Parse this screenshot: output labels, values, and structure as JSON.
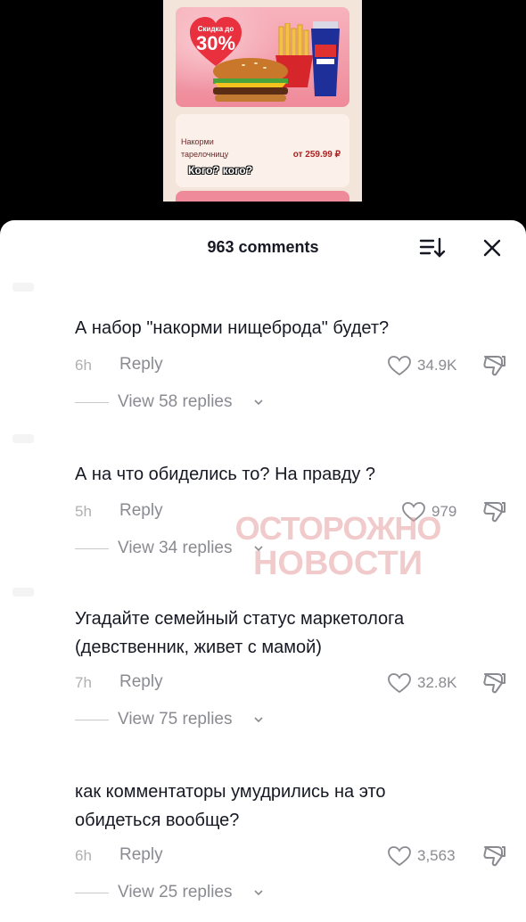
{
  "video": {
    "badge_small": "Скидка до",
    "badge_big": "30%",
    "product_name": "Накорми тарелочницу",
    "price": "от 259.99 ₽",
    "caption": "Кого? кого?"
  },
  "sheet": {
    "title": "963 comments",
    "sort_icon": "sort-icon",
    "close_icon": "close-icon"
  },
  "comments": [
    {
      "text": "А набор \"накорми нищеброда\" будет?",
      "time": "6h",
      "reply_label": "Reply",
      "likes": "34.9K",
      "view_replies": "View 58 replies"
    },
    {
      "text": "А на что обиделись то? На правду ?",
      "time": "5h",
      "reply_label": "Reply",
      "likes": "979",
      "view_replies": "View 34 replies"
    },
    {
      "text": "Угадайте семейный статус маркетолога (девственник, живет с мамой)",
      "time": "7h",
      "reply_label": "Reply",
      "likes": "32.8K",
      "view_replies": "View 75 replies"
    },
    {
      "text": "как комментаторы умудрились на это обидеться вообще?",
      "time": "6h",
      "reply_label": "Reply",
      "likes": "3,563",
      "view_replies": "View 25 replies"
    }
  ],
  "watermark": {
    "line1": "ОСТОРОЖНО",
    "line2": "НОВОСТИ"
  },
  "colors": {
    "text": "#161823",
    "muted": "#8a8b91",
    "sheet_bg": "#ffffff",
    "promo_pink": "#ef8a9a",
    "badge_red": "#e8303f"
  }
}
